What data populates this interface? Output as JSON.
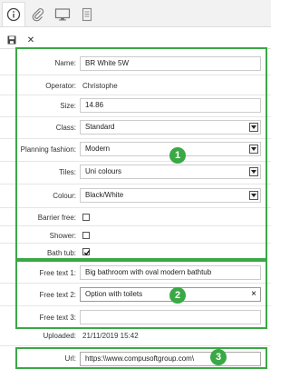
{
  "tabs": [
    {
      "icon": "info-icon",
      "active": true
    },
    {
      "icon": "paperclip-icon",
      "active": false
    },
    {
      "icon": "monitor-icon",
      "active": false
    },
    {
      "icon": "document-icon",
      "active": false
    }
  ],
  "toolbar": {
    "save_icon": "save-icon",
    "close_icon": "close-icon",
    "close_glyph": "✕"
  },
  "form": {
    "name": {
      "label": "Name:",
      "value": "BR White 5W"
    },
    "operator": {
      "label": "Operator:",
      "value": "Christophe"
    },
    "size": {
      "label": "Size:",
      "value": "14.86"
    },
    "class": {
      "label": "Class:",
      "value": "Standard"
    },
    "planning_fashion": {
      "label": "Planning fashion:",
      "value": "Modern"
    },
    "tiles": {
      "label": "Tiles:",
      "value": "Uni colours"
    },
    "colour": {
      "label": "Colour:",
      "value": "Black/White"
    },
    "barrier_free": {
      "label": "Barrier free:",
      "checked": false
    },
    "shower": {
      "label": "Shower:",
      "checked": false
    },
    "bath_tub": {
      "label": "Bath tub:",
      "checked": true
    },
    "free_text_1": {
      "label": "Free text 1:",
      "value": "Big bathroom with oval modern bathtub"
    },
    "free_text_2": {
      "label": "Free text 2:",
      "value": "Option with toilets",
      "clear_glyph": "×"
    },
    "free_text_3": {
      "label": "Free text 3:",
      "value": ""
    },
    "uploaded": {
      "label": "Uploaded:",
      "value": "21/11/2019 15:42"
    },
    "url": {
      "label": "Url:",
      "value": "https:\\\\www.compusoftgroup.com\\"
    }
  },
  "badges": [
    "1",
    "2",
    "3"
  ],
  "colors": {
    "accent_green": "#3aa845",
    "border": "#cccccc"
  }
}
